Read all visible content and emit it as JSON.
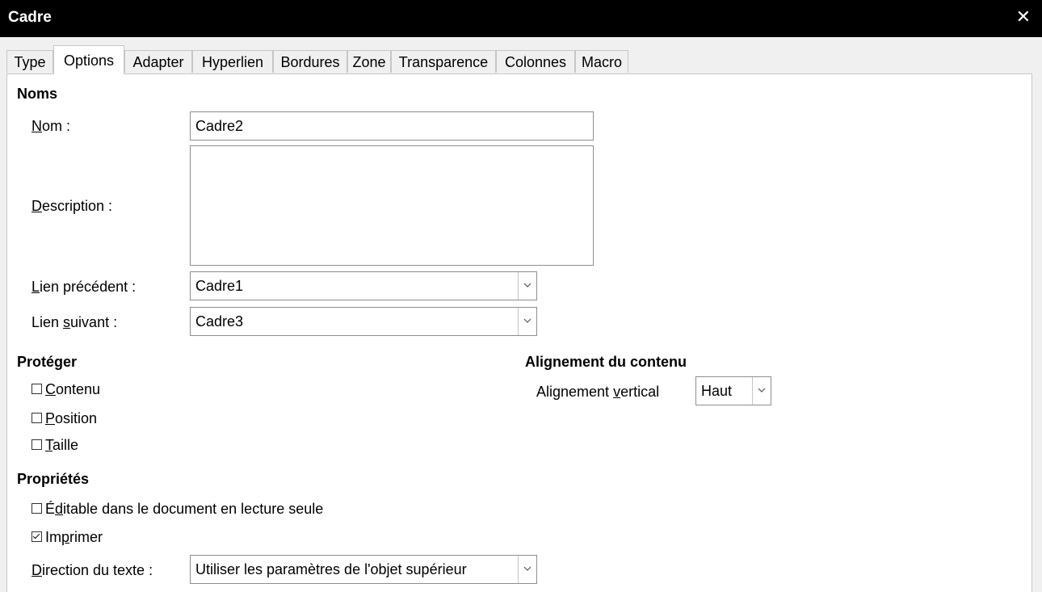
{
  "window": {
    "title": "Cadre",
    "close_glyph": "✕",
    "close_icon": "close-icon"
  },
  "tabs": [
    "Type",
    "Options",
    "Adapter",
    "Hyperlien",
    "Bordures",
    "Zone",
    "Transparence",
    "Colonnes",
    "Macro"
  ],
  "active_tab": "Options",
  "names": {
    "heading": "Noms",
    "name_label_accel": "N",
    "name_label_rest": "om :",
    "name_value": "Cadre2",
    "description_label_accel": "D",
    "description_label_rest": "escription :",
    "description_value": "",
    "prev_link_label_accel": "L",
    "prev_link_label_rest": "ien précédent :",
    "prev_link_value": "Cadre1",
    "next_link_label_pre": "Lien ",
    "next_link_label_accel": "s",
    "next_link_label_rest": "uivant :",
    "next_link_value": "Cadre3"
  },
  "protect": {
    "heading": "Protéger",
    "content_accel": "C",
    "content_rest": "ontenu",
    "content_checked": false,
    "position_accel": "P",
    "position_rest": "osition",
    "position_checked": false,
    "size_accel": "T",
    "size_rest": "aille",
    "size_checked": false
  },
  "alignment": {
    "heading": "Alignement du contenu",
    "vertical_label_pre": "Alignement ",
    "vertical_label_accel": "v",
    "vertical_label_rest": "ertical",
    "vertical_value": "Haut"
  },
  "properties": {
    "heading": "Propriétés",
    "editable_pre": "É",
    "editable_accel": "d",
    "editable_rest": "itable dans le document en lecture seule",
    "editable_checked": false,
    "print_pre": "Im",
    "print_accel": "p",
    "print_rest": "rimer",
    "print_checked": true,
    "text_direction_accel": "D",
    "text_direction_rest": "irection du texte :",
    "text_direction_value": "Utiliser les paramètres de l'objet supérieur"
  },
  "colors": {
    "titlebar": "#000000",
    "panel": "#ffffff",
    "background": "#f0f0f0",
    "border": "#8e8e8e"
  }
}
